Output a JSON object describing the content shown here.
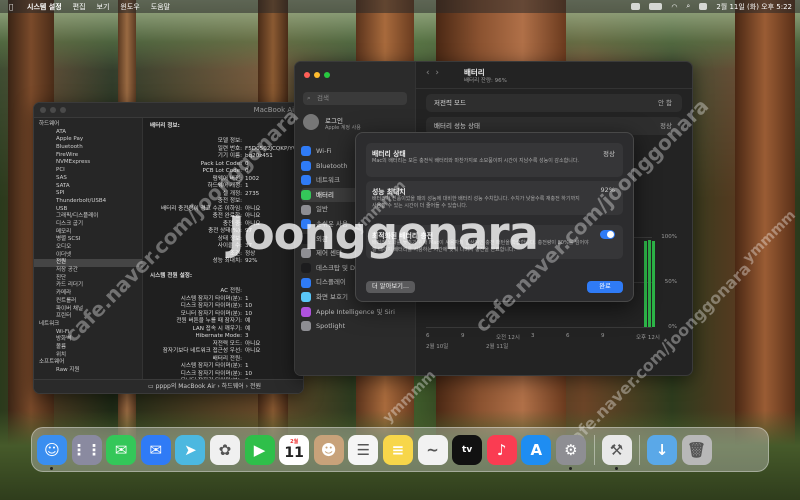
{
  "menubar": {
    "app_name": "시스템 설정",
    "menus": [
      "편집",
      "보기",
      "윈도우",
      "도움말"
    ],
    "datetime": "2월 11일 (화) 오후 5:22"
  },
  "system_info": {
    "title": "MacBook Air",
    "sidebar": [
      {
        "label": "하드웨어",
        "cat": true
      },
      {
        "label": "ATA"
      },
      {
        "label": "Apple Pay"
      },
      {
        "label": "Bluetooth"
      },
      {
        "label": "FireWire"
      },
      {
        "label": "NVMExpress"
      },
      {
        "label": "PCI"
      },
      {
        "label": "SAS"
      },
      {
        "label": "SATA"
      },
      {
        "label": "SPI"
      },
      {
        "label": "Thunderbolt/USB4"
      },
      {
        "label": "USB"
      },
      {
        "label": "그래픽/디스플레이"
      },
      {
        "label": "디스크 굽기"
      },
      {
        "label": "메모리"
      },
      {
        "label": "병렬 SCSI"
      },
      {
        "label": "오디오"
      },
      {
        "label": "이더넷"
      },
      {
        "label": "전원",
        "sel": true
      },
      {
        "label": "저장 공간"
      },
      {
        "label": "진단"
      },
      {
        "label": "카드 리더기"
      },
      {
        "label": "카메라"
      },
      {
        "label": "컨트롤러"
      },
      {
        "label": "파이버 채널"
      },
      {
        "label": "프린터"
      },
      {
        "label": "네트워크",
        "cat": true
      },
      {
        "label": "Wi-Fi"
      },
      {
        "label": "방화벽"
      },
      {
        "label": "볼륨"
      },
      {
        "label": "위치"
      },
      {
        "label": "소프트웨어",
        "cat": true
      },
      {
        "label": "Raw 지원"
      }
    ],
    "main": [
      {
        "k": "배터리 정보:",
        "v": "",
        "head": true
      },
      {
        "k": "",
        "v": ""
      },
      {
        "k": "모델 정보:",
        "v": ""
      },
      {
        "k": "일련 번호:",
        "v": "F5D0502JCQKP/YVAT"
      },
      {
        "k": "기기 이름:",
        "v": "bq20z451"
      },
      {
        "k": "Pack Lot Code:",
        "v": "0"
      },
      {
        "k": "PCB Lot Code:",
        "v": "0"
      },
      {
        "k": "펌웨어 버전:",
        "v": "1002"
      },
      {
        "k": "하드웨어 개정:",
        "v": "1"
      },
      {
        "k": "셀 개정:",
        "v": "2735"
      },
      {
        "k": "충전 정보:",
        "v": ""
      },
      {
        "k": "배터리 충전량이 경고 수준 이하임:",
        "v": "아니요"
      },
      {
        "k": "충전 완료함:",
        "v": "아니요"
      },
      {
        "k": "충전 중:",
        "v": "아니요"
      },
      {
        "k": "충전 상태(%):",
        "v": "97"
      },
      {
        "k": "상태 정보:",
        "v": ""
      },
      {
        "k": "사이클 수:",
        "v": "37"
      },
      {
        "k": "조건:",
        "v": "정상"
      },
      {
        "k": "성능 최대치:",
        "v": "92%"
      },
      {
        "k": "",
        "v": ""
      },
      {
        "k": "시스템 전원 설정:",
        "v": "",
        "head": true
      },
      {
        "k": "",
        "v": ""
      },
      {
        "k": "AC 전원:",
        "v": ""
      },
      {
        "k": "시스템 잠자기 타이머(분):",
        "v": "1"
      },
      {
        "k": "디스크 잠자기 타이머(분):",
        "v": "10"
      },
      {
        "k": "모니터 잠자기 타이머(분):",
        "v": "10"
      },
      {
        "k": "전원 버튼을 누를 때 잠자기:",
        "v": "예"
      },
      {
        "k": "LAN 접속 시 깨우기:",
        "v": "예"
      },
      {
        "k": "Hibernate Mode:",
        "v": "3"
      },
      {
        "k": "저전력 모드:",
        "v": "아니요"
      },
      {
        "k": "잠자기보다 네트워크 접근성 우선:",
        "v": "아니요"
      },
      {
        "k": "배터리 전원:",
        "v": ""
      },
      {
        "k": "시스템 잠자기 타이머(분):",
        "v": "1"
      },
      {
        "k": "디스크 잠자기 타이머(분):",
        "v": "10"
      },
      {
        "k": "모니터 잠자기 타이머(분):",
        "v": "2"
      }
    ],
    "path": "pppp의 MacBook Air › 하드웨어 › 전원"
  },
  "settings": {
    "search_placeholder": "검색",
    "account_name": "로그인",
    "account_sub": "Apple 계정 사용",
    "nav": [
      {
        "label": "Wi-Fi",
        "color": "#2f7bf6"
      },
      {
        "label": "Bluetooth",
        "color": "#2f7bf6"
      },
      {
        "label": "네트워크",
        "color": "#2f7bf6"
      },
      {
        "label": "배터리",
        "color": "#34c759",
        "sel": true
      },
      {
        "label": "일반",
        "color": "#8e8e93"
      },
      {
        "label": "손쉬운 사용",
        "color": "#2f7bf6"
      },
      {
        "label": "외관",
        "color": "#1c1c1e"
      },
      {
        "label": "제어 센터",
        "color": "#8e8e93"
      },
      {
        "label": "데스크탑 및 Dock",
        "color": "#1c1c1e"
      },
      {
        "label": "디스플레이",
        "color": "#2f7bf6"
      },
      {
        "label": "화면 보호기",
        "color": "#5ac8fa"
      },
      {
        "label": "Apple Intelligence 및 Siri",
        "color": "#af52de"
      },
      {
        "label": "Spotlight",
        "color": "#8e8e93"
      }
    ],
    "header_title": "배터리",
    "header_sub": "배터리 잔량: 96%",
    "low_power_label": "저전력 모드",
    "low_power_value": "안 함",
    "health_label": "배터리 성능 상태",
    "health_value": "정상",
    "chart_data": {
      "type": "bar",
      "title": "",
      "y_ticks": [
        "100%",
        "50%",
        "0%"
      ],
      "x_ticks": [
        "6",
        "9",
        "오전 12시",
        "3",
        "6",
        "9",
        "오후 12시"
      ],
      "x_groups": [
        "2월 10일",
        "2월 11일"
      ],
      "series": [
        {
          "values": [
            96,
            97,
            96
          ]
        }
      ]
    }
  },
  "sheet": {
    "sec1_title": "배터리 상태",
    "sec1_value": "정상",
    "sec1_desc": "Mac의 배터리는 모든 충전식 배터리와 마찬가지로 소모품이며 시간이 지남수록 성능이 감소합니다.",
    "sec2_title": "성능 최대치",
    "sec2_value": "92%",
    "sec2_desc": "배터리가 신품이었을 때의 성능에 대비한 배터리 성능 수치입니다. 수치가 낮을수록 재충전 하기까지 사용할 수 있는 시간이 더 줄어들 수 있습니다.",
    "sec3_title": "최적화된 배터리 충전",
    "sec3_desc": "배터리 노화를 늦추기 위해 Mac이 사용자의 일상적인 충전 패턴을 학습합니다. 충전량이 80%를 넘어야 할 때까지 배터리를 사용하는 시간에 맞춰 나머지 충전을 완료합니다.",
    "more_button": "더 알아보기...",
    "done_button": "완료"
  },
  "watermark": {
    "logo": "Joonggonara",
    "texts": [
      "cafe.naver.com/joonggonara",
      "ymmmm"
    ]
  },
  "dock": {
    "calendar_month": "2월",
    "calendar_day": "11",
    "apps": [
      {
        "name": "finder-icon",
        "color": "#3a8ef0",
        "glyph": "☺"
      },
      {
        "name": "launchpad-icon",
        "color": "#8a8aa0",
        "glyph": "⋮⋮"
      },
      {
        "name": "messages-icon",
        "color": "#34c759",
        "glyph": "✉"
      },
      {
        "name": "mail-icon",
        "color": "#2f7bf6",
        "glyph": "✉"
      },
      {
        "name": "maps-icon",
        "color": "#4cb8e0",
        "glyph": "➤"
      },
      {
        "name": "photos-icon",
        "color": "#f0f0f0",
        "glyph": "✿"
      },
      {
        "name": "facetime-icon",
        "color": "#2fbf4a",
        "glyph": "▶"
      },
      {
        "name": "calendar-icon",
        "color": "#ffffff",
        "glyph": ""
      },
      {
        "name": "contacts-icon",
        "color": "#c8a27a",
        "glyph": "☻"
      },
      {
        "name": "reminders-icon",
        "color": "#f5f5f5",
        "glyph": "☰"
      },
      {
        "name": "notes-icon",
        "color": "#f7d64a",
        "glyph": "≡"
      },
      {
        "name": "freeform-icon",
        "color": "#f2f2f2",
        "glyph": "~"
      },
      {
        "name": "tv-icon",
        "color": "#111111",
        "glyph": "tv"
      },
      {
        "name": "music-icon",
        "color": "#fa3c52",
        "glyph": "♪"
      },
      {
        "name": "app-store-icon",
        "color": "#1e8df2",
        "glyph": "A"
      },
      {
        "name": "system-settings-icon",
        "color": "#8e8e93",
        "glyph": "⚙"
      },
      {
        "name": "system-information-icon",
        "color": "#e8e8e8",
        "glyph": "⚒"
      },
      {
        "name": "downloads-icon",
        "color": "#5aa8e8",
        "glyph": "↓"
      },
      {
        "name": "trash-icon",
        "color": "#b8b8b8",
        "glyph": "🗑"
      }
    ]
  }
}
